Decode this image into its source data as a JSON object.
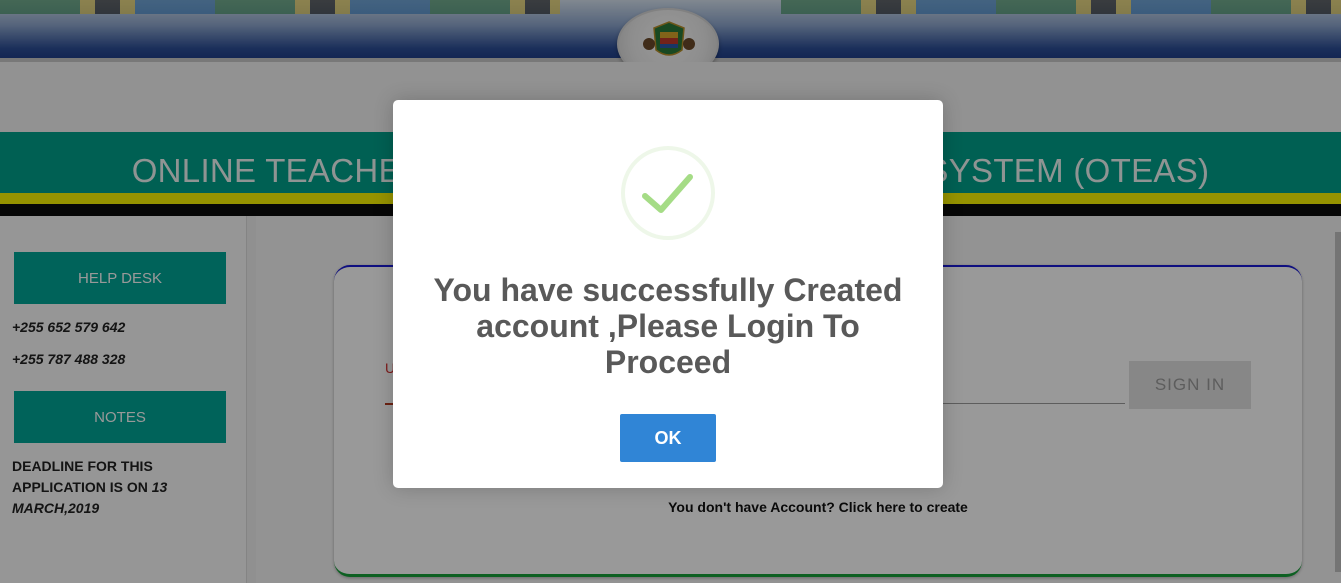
{
  "header": {
    "title": "ONLINE TEACHERS EMPLOYMENT APPLICATION SYSTEM (OTEAS)",
    "emblem": "coat-of-arms-icon"
  },
  "sidebar": {
    "help_desk_label": "HELP DESK",
    "phones": [
      "+255 652 579 642",
      "+255 787 488 328"
    ],
    "notes_label": "NOTES",
    "deadline_prefix": "DEADLINE FOR THIS APPLICATION IS ON",
    "deadline_date": "13 MARCH,2019"
  },
  "login": {
    "username_label": "U",
    "signin_label": "SIGN IN",
    "create_account_text": "You don't have Account? Click here to create"
  },
  "modal": {
    "icon": "success-check-icon",
    "message": "You have successfully Created account ,Please Login To Proceed",
    "ok_label": "OK"
  },
  "colors": {
    "teal": "#00a18a",
    "yellow": "#fbf600",
    "ok_button": "#3085d6",
    "success_green": "#a5dc86"
  }
}
